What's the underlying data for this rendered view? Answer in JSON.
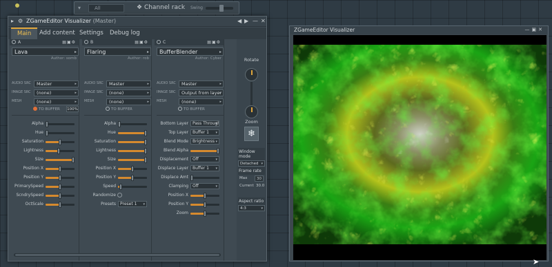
{
  "channel_rack": {
    "filter": "All",
    "title": "Channel rack",
    "swing_label": "Swing"
  },
  "plugin": {
    "title": "ZGameEditor Visualizer",
    "subtitle": "(Master)",
    "tabs": [
      "Main",
      "Add content",
      "Settings",
      "Debug log"
    ],
    "active_tab": "Main",
    "layers": [
      {
        "id": "A",
        "effect": "Lava",
        "author": "Author: somb",
        "audio_src": "Master",
        "image_src": "(none)",
        "mesh": "(none)",
        "to_buffer": "TO BUFFER",
        "to_buffer_on": true,
        "percent": "100%",
        "params": [
          {
            "label": "Alpha",
            "value": 0.05
          },
          {
            "label": "Hue",
            "value": 0.05
          },
          {
            "label": "Saturation",
            "value": 0.5
          },
          {
            "label": "Lightness",
            "value": 0.45
          },
          {
            "label": "Size",
            "value": 0.95
          },
          {
            "label": "Position X",
            "value": 0.5
          },
          {
            "label": "Position Y",
            "value": 0.5
          },
          {
            "label": "PrimarySpeed",
            "value": 0.5
          },
          {
            "label": "ScndrySpeed",
            "value": 0.5
          },
          {
            "label": "OctScale",
            "value": 0.5
          }
        ]
      },
      {
        "id": "B",
        "effect": "Flaring",
        "author": "Author: rob",
        "audio_src": "Master",
        "image_src": "(none)",
        "mesh": "(none)",
        "to_buffer": "TO BUFFER",
        "to_buffer_on": false,
        "params": [
          {
            "label": "Alpha",
            "value": 0.05,
            "kind": "slider"
          },
          {
            "label": "Hue",
            "value": 0.95,
            "kind": "slider"
          },
          {
            "label": "Saturation",
            "value": 0.95,
            "kind": "slider"
          },
          {
            "label": "Lightness",
            "value": 0.95,
            "kind": "slider"
          },
          {
            "label": "Size",
            "value": 0.95,
            "kind": "slider"
          },
          {
            "label": "Position X",
            "value": 0.5,
            "kind": "slider"
          },
          {
            "label": "Position Y",
            "value": 0.5,
            "kind": "slider"
          },
          {
            "label": "Speed",
            "value": 0.1,
            "kind": "slider"
          },
          {
            "label": "Randomize",
            "kind": "radio"
          },
          {
            "label": "Presets",
            "kind": "dropdown",
            "text": "Preset 1"
          }
        ]
      },
      {
        "id": "C",
        "effect": "BufferBlender",
        "author": "Author: Cyber",
        "audio_src": "Master",
        "image_src": "Output from layer A",
        "mesh": "(none)",
        "to_buffer": "TO BUFFER",
        "to_buffer_on": false,
        "params": [
          {
            "label": "Bottom Layer",
            "kind": "dropdown",
            "text": "Pass Through"
          },
          {
            "label": "Top Layer",
            "kind": "dropdown",
            "text": "Buffer 1"
          },
          {
            "label": "Blend Mode",
            "kind": "dropdown",
            "text": "Brightness"
          },
          {
            "label": "Blend Alpha",
            "value": 0.95,
            "kind": "slider"
          },
          {
            "label": "Displacement",
            "kind": "dropdown",
            "text": "Off"
          },
          {
            "label": "Displace Layer",
            "kind": "dropdown",
            "text": "Buffer 1"
          },
          {
            "label": "Displace Amt",
            "value": 0.05,
            "kind": "slider"
          },
          {
            "label": "Clamping",
            "kind": "dropdown",
            "text": "Off"
          },
          {
            "label": "Position X",
            "value": 0.5,
            "kind": "slider"
          },
          {
            "label": "Position Y",
            "value": 0.5,
            "kind": "slider"
          },
          {
            "label": "Zoom",
            "value": 0.5,
            "kind": "slider"
          }
        ]
      }
    ],
    "field_labels": {
      "audio": "AUDIO SRC",
      "image": "IMAGE SRC",
      "mesh": "MESH"
    },
    "right_panel": {
      "rotate_label": "Rotate",
      "zoom_label": "Zoom",
      "window_mode_label": "Window mode",
      "window_mode": "Detached",
      "frame_rate_label": "Frame rate",
      "max_label": "Max",
      "max_value": "30",
      "current_label": "Current",
      "current_value": "30.0",
      "aspect_label": "Aspect ratio",
      "aspect_value": "4:3"
    }
  },
  "output_window": {
    "title": "ZGameEditor Visualizer"
  },
  "colors": {
    "accent": "#e0a63a",
    "slider_fill": "#d68a2e",
    "green": "#3cc81a",
    "yellow": "#d8e028"
  }
}
